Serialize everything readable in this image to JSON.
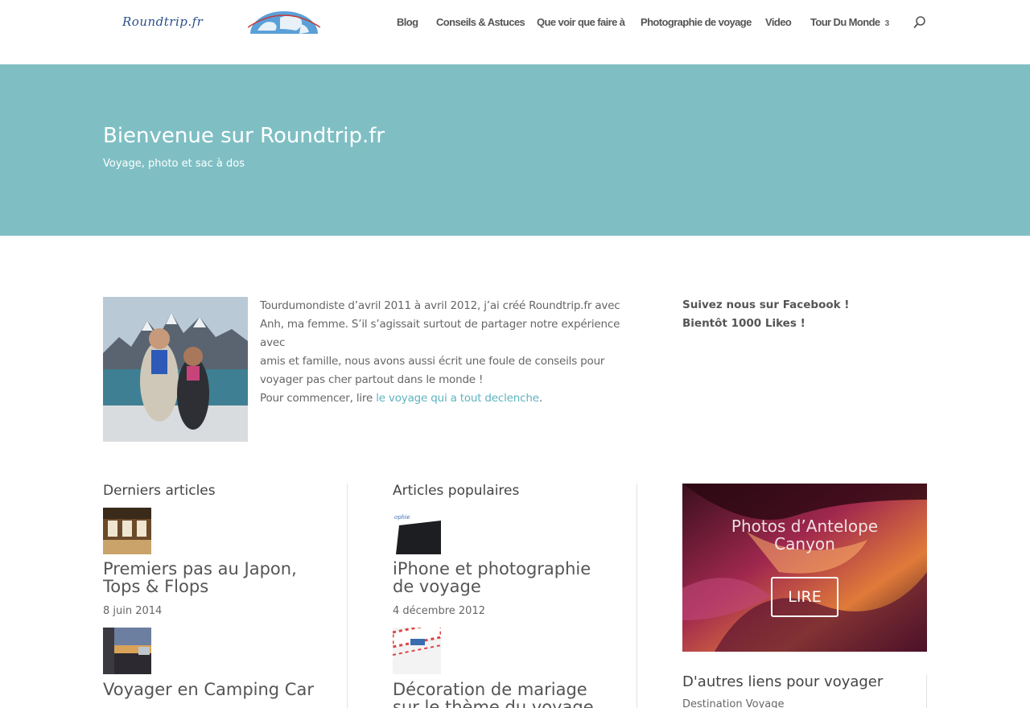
{
  "header": {
    "logo_text": "Roundtrip.fr",
    "nav": [
      {
        "label": "Blog"
      },
      {
        "label": "Conseils & Astuces"
      },
      {
        "label": "Que voir que faire à"
      },
      {
        "label": "Photographie de voyage"
      },
      {
        "label": "Video"
      },
      {
        "label": "Tour Du Monde",
        "has_dropdown": true
      }
    ],
    "icons": {
      "search": "search-icon",
      "dropdown": "chevron-down-icon"
    }
  },
  "hero": {
    "title": "Bienvenue sur Roundtrip.fr",
    "subtitle": "Voyage, photo et sac à dos"
  },
  "intro": {
    "text_lines": [
      "Tourdumondiste d’avril 2011 à avril 2012, j’ai créé Roundtrip.fr avec",
      "Anh, ma femme. S’il s’agissait surtout de partager notre expérience avec",
      "amis et famille, nous avons aussi écrit une foule de conseils pour",
      "voyager pas cher partout dans le monde !"
    ],
    "cta_prefix": "Pour commencer, lire ",
    "cta_link": "le voyage qui a tout declenche",
    "cta_suffix": "."
  },
  "facebook": {
    "line1": "Suivez nous sur Facebook !",
    "line2": "Bientôt 1000 Likes !"
  },
  "latest": {
    "title": "Derniers articles",
    "posts": [
      {
        "title_lines": [
          "Premiers pas au Japon,",
          "Tops & Flops"
        ],
        "date": "8 juin 2014"
      },
      {
        "title_lines": [
          "Voyager en Camping Car"
        ],
        "date": ""
      }
    ]
  },
  "popular": {
    "title": "Articles populaires",
    "posts": [
      {
        "title_lines": [
          "iPhone et photographie",
          "de voyage"
        ],
        "date": "4 décembre 2012"
      },
      {
        "title_lines": [
          "Décoration de mariage",
          "sur le thème du voyage"
        ],
        "date": ""
      }
    ]
  },
  "promo": {
    "title_lines": [
      "Photos d’Antelope",
      "Canyon"
    ],
    "button": "LIRE"
  },
  "links": {
    "title": "D'autres liens pour voyager",
    "items": [
      "Destination Voyage"
    ]
  },
  "colors": {
    "hero_bg": "#7fbfc4",
    "link": "#5fb3c0",
    "text": "#666666",
    "heading": "#444444"
  }
}
